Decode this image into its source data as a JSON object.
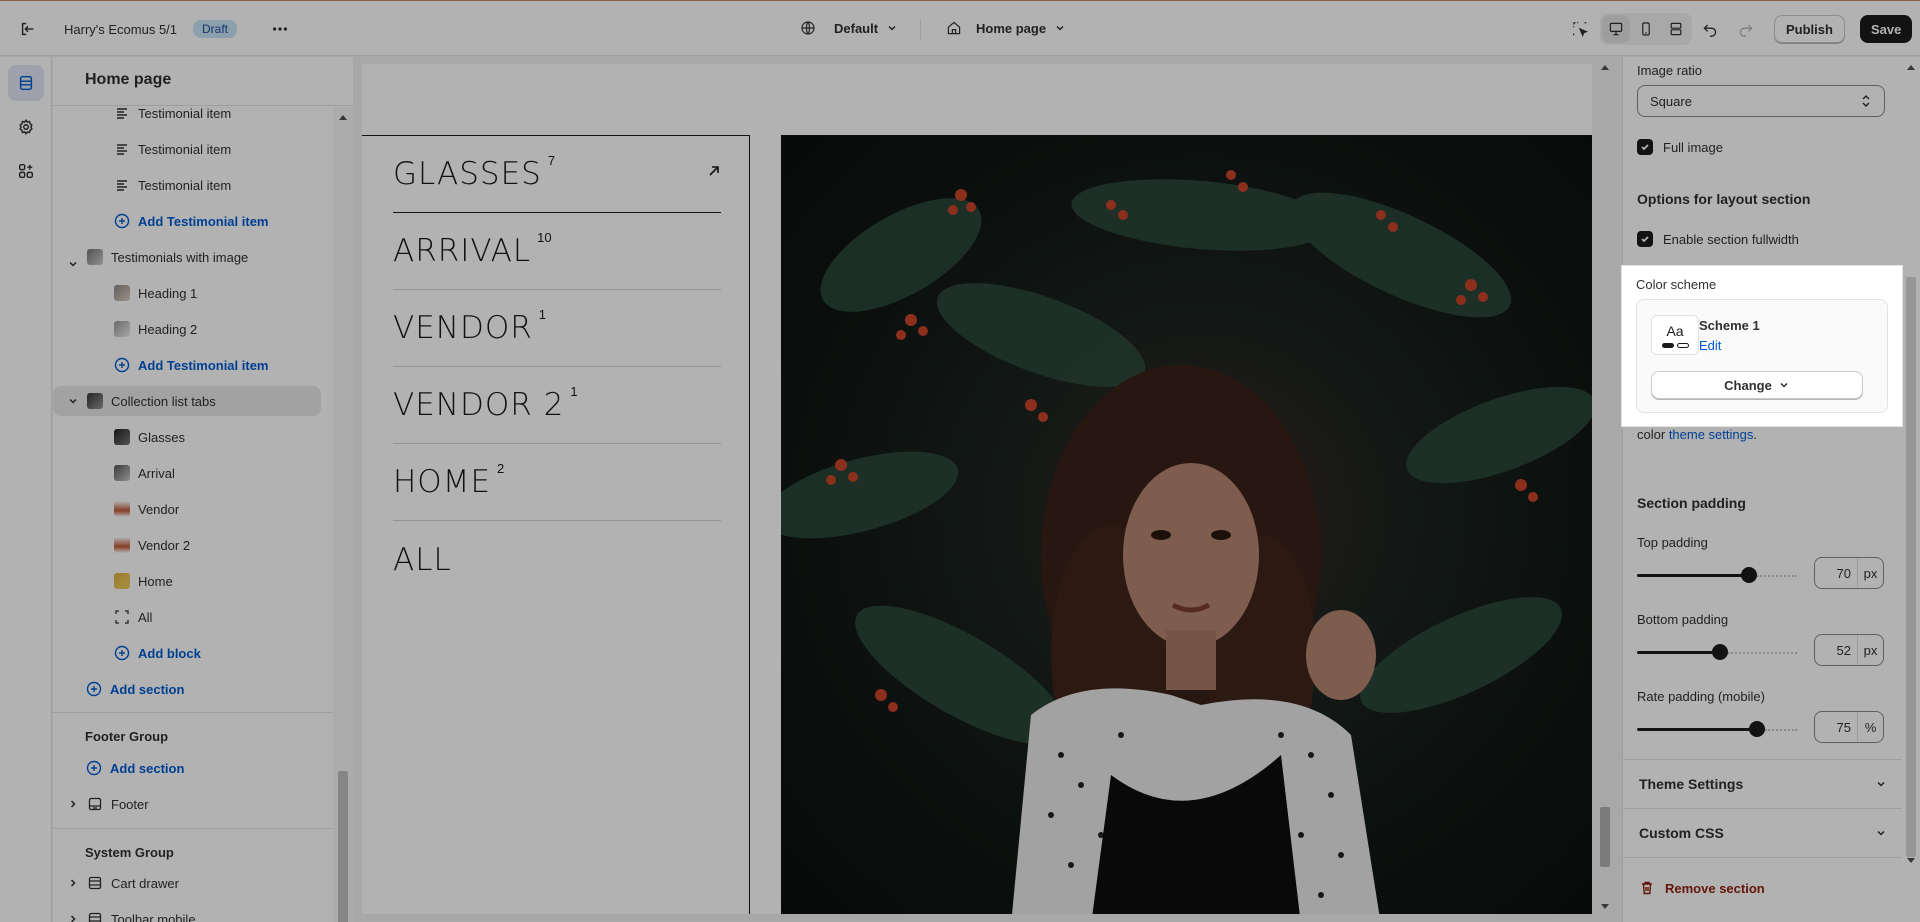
{
  "topbar": {
    "store_name": "Harry's Ecomus 5/1",
    "status_badge": "Draft",
    "theme_select": "Default",
    "page_select": "Home page",
    "publish_label": "Publish",
    "save_label": "Save"
  },
  "sidebar": {
    "title": "Home page",
    "items": [
      {
        "label": "Testimonial item",
        "icon": "text-lines-icon"
      },
      {
        "label": "Testimonial item",
        "icon": "text-lines-icon"
      },
      {
        "label": "Testimonial item",
        "icon": "text-lines-icon"
      },
      {
        "label": "Add Testimonial item",
        "icon": "plus-circle-icon"
      },
      {
        "label": "Testimonials with image",
        "icon": "image-thumb-icon"
      },
      {
        "label": "Heading 1",
        "icon": "image-thumb-icon"
      },
      {
        "label": "Heading 2",
        "icon": "image-thumb-icon"
      },
      {
        "label": "Add Testimonial item",
        "icon": "plus-circle-icon"
      },
      {
        "label": "Collection list tabs",
        "icon": "image-thumb-icon"
      },
      {
        "label": "Glasses",
        "icon": "image-thumb-icon"
      },
      {
        "label": "Arrival",
        "icon": "image-thumb-icon"
      },
      {
        "label": "Vendor",
        "icon": "image-thumb-icon"
      },
      {
        "label": "Vendor 2",
        "icon": "image-thumb-icon"
      },
      {
        "label": "Home",
        "icon": "image-thumb-icon"
      },
      {
        "label": "All",
        "icon": "dashed-frame-icon"
      },
      {
        "label": "Add block",
        "icon": "plus-circle-icon"
      },
      {
        "label": "Add section",
        "icon": "plus-circle-icon"
      }
    ],
    "footer_group": {
      "label": "Footer Group",
      "add_section": "Add section",
      "footer": "Footer"
    },
    "system_group": {
      "label": "System Group",
      "cart_drawer": "Cart drawer",
      "toolbar_mobile": "Toolbar mobile"
    }
  },
  "preview": {
    "collections": [
      {
        "name": "GLASSES",
        "count": "7"
      },
      {
        "name": "ARRIVAL",
        "count": "10"
      },
      {
        "name": "VENDOR",
        "count": "1"
      },
      {
        "name": "VENDOR 2",
        "count": "1"
      },
      {
        "name": "HOME",
        "count": "2"
      },
      {
        "name": "ALL",
        "count": ""
      }
    ]
  },
  "settings": {
    "image_ratio_label": "Image ratio",
    "image_ratio_value": "Square",
    "full_image_label": "Full image",
    "full_image_checked": true,
    "layout_heading": "Options for layout section",
    "fullwidth_label": "Enable section fullwidth",
    "fullwidth_checked": true,
    "color_scheme_label": "Color scheme",
    "scheme_preview_text": "Aa",
    "scheme_name": "Scheme 1",
    "scheme_edit": "Edit",
    "change_label": "Change",
    "help_text": "To edit all your theme's colors, go to your color",
    "help_link": "theme settings",
    "help_period": ".",
    "padding_heading": "Section padding",
    "top_padding_label": "Top padding",
    "top_padding_value": "70",
    "top_padding_unit": "px",
    "top_padding_fraction": 0.7,
    "bottom_padding_label": "Bottom padding",
    "bottom_padding_value": "52",
    "bottom_padding_unit": "px",
    "bottom_padding_fraction": 0.52,
    "rate_padding_label": "Rate padding (mobile)",
    "rate_padding_value": "75",
    "rate_padding_unit": "%",
    "rate_padding_fraction": 0.75,
    "theme_settings_label": "Theme Settings",
    "custom_css_label": "Custom CSS",
    "remove_section_label": "Remove section"
  },
  "colors": {
    "accent": "#005bd3",
    "danger": "#8e1f0b",
    "badge_bg": "#c9e4f7",
    "dark": "#1a1a1a"
  }
}
